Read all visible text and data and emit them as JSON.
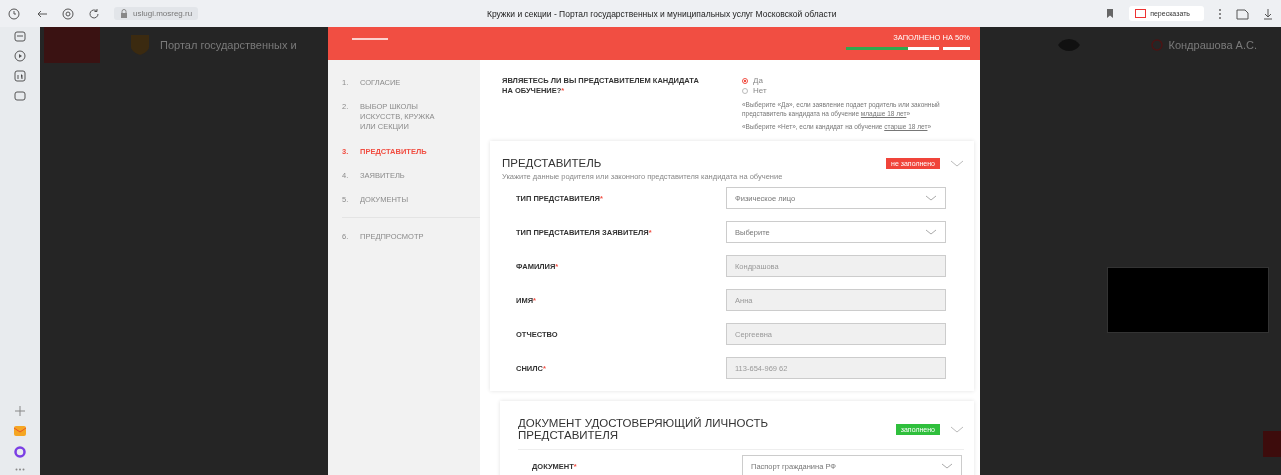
{
  "browser": {
    "url": "uslugi.mosreg.ru",
    "title": "Кружки и секции - Портал государственных и муниципальных услуг Московской области",
    "retell_button": "пересказать"
  },
  "portal": {
    "title": "Портал государственных и",
    "user": "Кондрашова А.С."
  },
  "form": {
    "progress_label": "ЗАПОЛНЕНО НА 50%",
    "progress": {
      "level": 0.5
    },
    "steps": [
      {
        "number": "1.",
        "label": "СОГЛАСИЕ",
        "selected": false
      },
      {
        "number": "2.",
        "label": "ВЫБОР ШКОЛЫ ИСКУССТВ, КРУЖКА ИЛИ СЕКЦИИ",
        "selected": false
      },
      {
        "number": "3.",
        "label": "ПРЕДСТАВИТЕЛЬ",
        "selected": true
      },
      {
        "number": "4.",
        "label": "ЗАЯВИТЕЛЬ",
        "selected": false
      },
      {
        "number": "5.",
        "label": "ДОКУМЕНТЫ",
        "selected": false
      },
      {
        "number": "6.",
        "label": "ПРЕДПРОСМОТР",
        "selected": false
      }
    ],
    "question": {
      "label": "ЯВЛЯЕТЕСЬ ЛИ ВЫ ПРЕДСТАВИТЕЛЕМ КАНДИДАТА НА ОБУЧЕНИЕ?",
      "required_mark": "*",
      "options": [
        {
          "label": "Да",
          "selected": true
        },
        {
          "label": "Нет",
          "selected": false
        }
      ],
      "hints": [
        {
          "text": "«Выберите «Да», если заявление подает родитель или законный представитель кандидата на обучение",
          "link": "младше 18 лет",
          "after": "»"
        },
        {
          "text": "«Выберите «Нет», если кандидат на обучение",
          "link": "старше 18 лет",
          "after": "»"
        }
      ]
    },
    "sections": [
      {
        "title": "ПРЕДСТАВИТЕЛЬ",
        "status": "не заполнено",
        "color": "#f0443a",
        "subtitle": "Укажите данные родителя или законного представителя кандидата на обучение",
        "fields": [
          {
            "label": "ТИП ПРЕДСТАВИТЕЛЯ",
            "required_mark": "*",
            "kind": "select",
            "value": "Физическое лицо"
          },
          {
            "label": "ТИП ПРЕДСТАВИТЕЛЯ ЗАЯВИТЕЛЯ",
            "required_mark": "*",
            "kind": "select",
            "value": "Выберите"
          },
          {
            "label": "ФАМИЛИЯ",
            "required_mark": "*",
            "kind": "text",
            "value": "Кондрашова"
          },
          {
            "label": "ИМЯ",
            "required_mark": "*",
            "kind": "text",
            "value": "Анна"
          },
          {
            "label": "ОТЧЕСТВО",
            "kind": "text",
            "value": "Сергеевна"
          },
          {
            "label": "СНИЛС",
            "required_mark": "*",
            "kind": "text",
            "value": "113-654-969 62"
          }
        ]
      },
      {
        "title": "ДОКУМЕНТ УДОСТОВЕРЯЮЩИЙ ЛИЧНОСТЬ ПРЕДСТАВИТЕЛЯ",
        "status": "заполнено",
        "color": "#2fbf3c",
        "fields": [
          {
            "label": "ДОКУМЕНТ",
            "required_mark": "*",
            "kind": "select",
            "value": "Паспорт гражданина РФ"
          }
        ]
      }
    ]
  }
}
